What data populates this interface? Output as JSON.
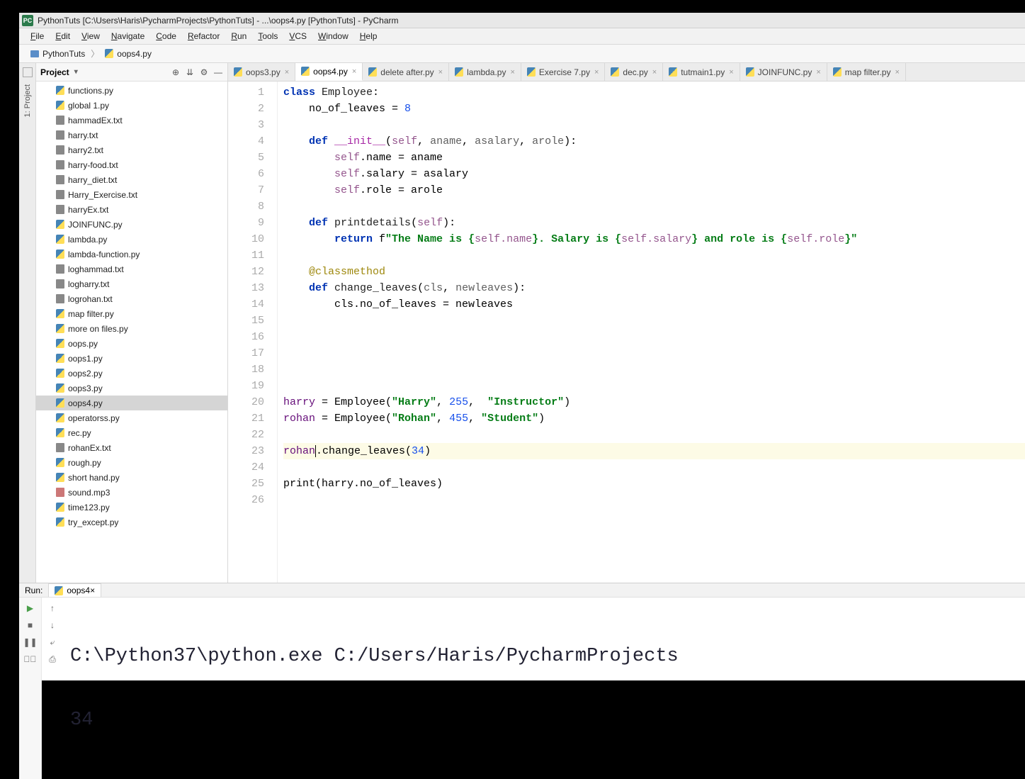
{
  "titlebar": {
    "icon": "PC",
    "text": "PythonTuts [C:\\Users\\Haris\\PycharmProjects\\PythonTuts] - ...\\oops4.py [PythonTuts] - PyCharm"
  },
  "menu": [
    "File",
    "Edit",
    "View",
    "Navigate",
    "Code",
    "Refactor",
    "Run",
    "Tools",
    "VCS",
    "Window",
    "Help"
  ],
  "breadcrumb": {
    "project": "PythonTuts",
    "file": "oops4.py"
  },
  "project_panel": {
    "title": "Project"
  },
  "tree": [
    {
      "name": "functions.py",
      "type": "py"
    },
    {
      "name": "global 1.py",
      "type": "py"
    },
    {
      "name": "hammadEx.txt",
      "type": "txt"
    },
    {
      "name": "harry.txt",
      "type": "txt"
    },
    {
      "name": "harry2.txt",
      "type": "txt"
    },
    {
      "name": "harry-food.txt",
      "type": "txt"
    },
    {
      "name": "harry_diet.txt",
      "type": "txt"
    },
    {
      "name": "Harry_Exercise.txt",
      "type": "txt"
    },
    {
      "name": "harryEx.txt",
      "type": "txt"
    },
    {
      "name": "JOINFUNC.py",
      "type": "py"
    },
    {
      "name": "lambda.py",
      "type": "py"
    },
    {
      "name": "lambda-function.py",
      "type": "py"
    },
    {
      "name": "loghammad.txt",
      "type": "txt"
    },
    {
      "name": "logharry.txt",
      "type": "txt"
    },
    {
      "name": "logrohan.txt",
      "type": "txt"
    },
    {
      "name": "map filter.py",
      "type": "py"
    },
    {
      "name": "more on files.py",
      "type": "py"
    },
    {
      "name": "oops.py",
      "type": "py"
    },
    {
      "name": "oops1.py",
      "type": "py"
    },
    {
      "name": "oops2.py",
      "type": "py"
    },
    {
      "name": "oops3.py",
      "type": "py"
    },
    {
      "name": "oops4.py",
      "type": "py",
      "selected": true
    },
    {
      "name": "operatorss.py",
      "type": "py"
    },
    {
      "name": "rec.py",
      "type": "py"
    },
    {
      "name": "rohanEx.txt",
      "type": "txt"
    },
    {
      "name": "rough.py",
      "type": "py"
    },
    {
      "name": "short hand.py",
      "type": "py"
    },
    {
      "name": "sound.mp3",
      "type": "mp3"
    },
    {
      "name": "time123.py",
      "type": "py"
    },
    {
      "name": "try_except.py",
      "type": "py"
    }
  ],
  "tabs": [
    {
      "label": "oops3.py"
    },
    {
      "label": "oops4.py",
      "active": true
    },
    {
      "label": "delete after.py"
    },
    {
      "label": "lambda.py"
    },
    {
      "label": "Exercise 7.py"
    },
    {
      "label": "dec.py"
    },
    {
      "label": "tutmain1.py"
    },
    {
      "label": "JOINFUNC.py"
    },
    {
      "label": "map filter.py"
    }
  ],
  "code": {
    "lines": [
      1,
      2,
      3,
      4,
      5,
      6,
      7,
      8,
      9,
      10,
      11,
      12,
      13,
      14,
      15,
      16,
      17,
      18,
      19,
      20,
      21,
      22,
      23,
      24,
      25,
      26
    ],
    "tok": {
      "class": "class ",
      "Employee": "Employee",
      "colon": ":",
      "no_of_leaves": "no_of_leaves",
      " = ": " = ",
      "eight": "8",
      "def": "def ",
      "init": "__init__",
      "lp": "(",
      "rp": ")",
      "self": "self",
      ", ": ", ",
      "aname": "aname",
      "asalary": "asalary",
      "arole": "arole",
      "selfdot": "self.",
      "name": "name",
      "eq": " = ",
      "salary": "salary",
      "role": "role",
      "printdetails": "printdetails",
      "return": "return ",
      "fpre": "f",
      "q": "\"",
      "s1": "The Name is {",
      "sname": "self.name",
      "s2": "}. Salary is {",
      "ssal": "self.salary",
      "s3": "} and role is {",
      "srole": "self.role",
      "s4": "}",
      "classmethod": "@classmethod",
      "change_leaves": "change_leaves",
      "cls": "cls",
      "newleaves": "newleaves",
      "clsdot": "cls.",
      "harry": "harry",
      "rohan": "rohan",
      "EmployeeC": "Employee",
      "qHarry": "\"Harry\"",
      "n255": "255",
      "qInstr": "\"Instructor\"",
      "qRohan": "\"Rohan\"",
      "n455": "455",
      "qStud": "\"Student\"",
      "dotchange": ".change_leaves(",
      "n34": "34",
      "cp": ")",
      "print": "print",
      "harrydot": "harry."
    }
  },
  "run": {
    "label": "Run:",
    "tab": "oops4",
    "line1": "C:\\Python37\\python.exe C:/Users/Haris/PycharmProjects",
    "line2": "34"
  },
  "rail": {
    "project": "1: Project"
  }
}
